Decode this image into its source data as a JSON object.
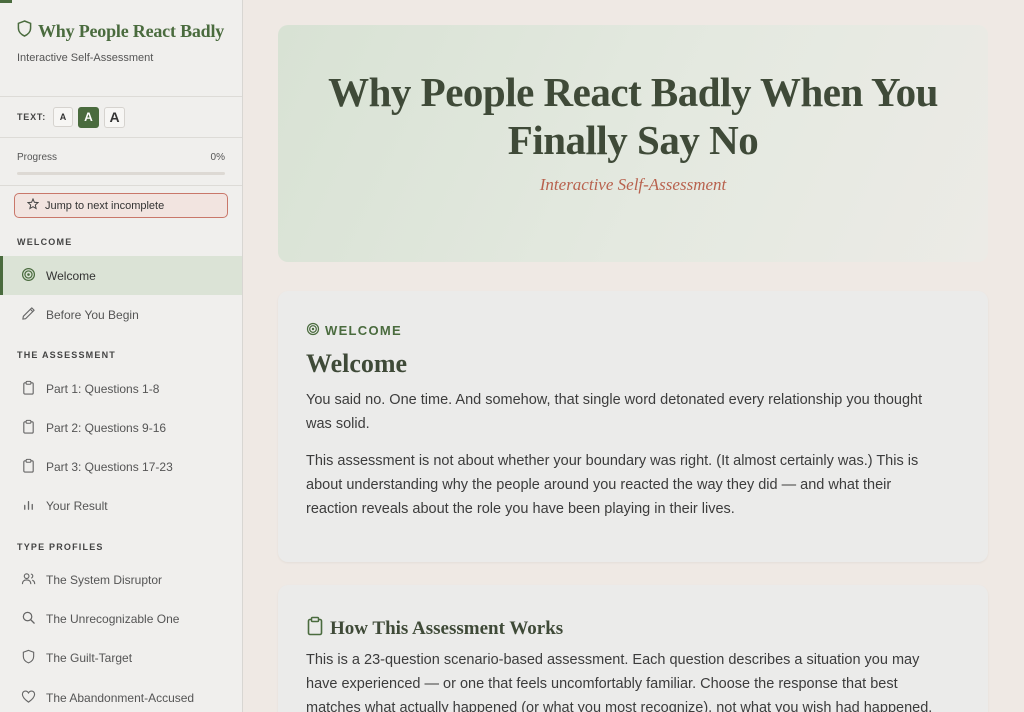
{
  "app": {
    "title": "Why People React Badly",
    "subtitle": "Interactive Self-Assessment"
  },
  "text_size": {
    "label": "TEXT:",
    "small": "A",
    "medium": "A",
    "large": "A",
    "selected": "medium"
  },
  "progress": {
    "label": "Progress",
    "value_text": "0%",
    "fraction": 0
  },
  "jump_button": "Jump to next incomplete",
  "sidebar": {
    "sections": [
      {
        "title": "WELCOME",
        "items": [
          {
            "label": "Welcome",
            "icon": "target-icon",
            "active": true
          },
          {
            "label": "Before You Begin",
            "icon": "pencil-icon"
          }
        ]
      },
      {
        "title": "THE ASSESSMENT",
        "items": [
          {
            "label": "Part 1: Questions 1-8",
            "icon": "clipboard-icon"
          },
          {
            "label": "Part 2: Questions 9-16",
            "icon": "clipboard-icon"
          },
          {
            "label": "Part 3: Questions 17-23",
            "icon": "clipboard-icon"
          },
          {
            "label": "Your Result",
            "icon": "bar-chart-icon"
          }
        ]
      },
      {
        "title": "TYPE PROFILES",
        "items": [
          {
            "label": "The System Disruptor",
            "icon": "users-icon"
          },
          {
            "label": "The Unrecognizable One",
            "icon": "search-icon"
          },
          {
            "label": "The Guilt-Target",
            "icon": "shield-icon"
          },
          {
            "label": "The Abandonment-Accused",
            "icon": "heart-icon"
          }
        ]
      }
    ]
  },
  "hero": {
    "title": "Why People React Badly When You Finally Say No",
    "tagline": "Interactive Self-Assessment"
  },
  "welcome_card": {
    "eyebrow": "WELCOME",
    "heading": "Welcome",
    "paragraphs": [
      "You said no. One time. And somehow, that single word detonated every relationship you thought was solid.",
      "This assessment is not about whether your boundary was right. (It almost certainly was.) This is about understanding why the people around you reacted the way they did — and what their reaction reveals about the role you have been playing in their lives."
    ]
  },
  "how_card": {
    "heading": "How This Assessment Works",
    "paragraph": "This is a 23-question scenario-based assessment. Each question describes a situation you may have experienced — or one that feels uncomfortably familiar. Choose the response that best matches what actually happened (or what you most recognize), not what you wish had happened."
  },
  "colors": {
    "accent": "#4a6b3e",
    "tagline": "#b8624e",
    "jump_border": "#c9776a"
  }
}
